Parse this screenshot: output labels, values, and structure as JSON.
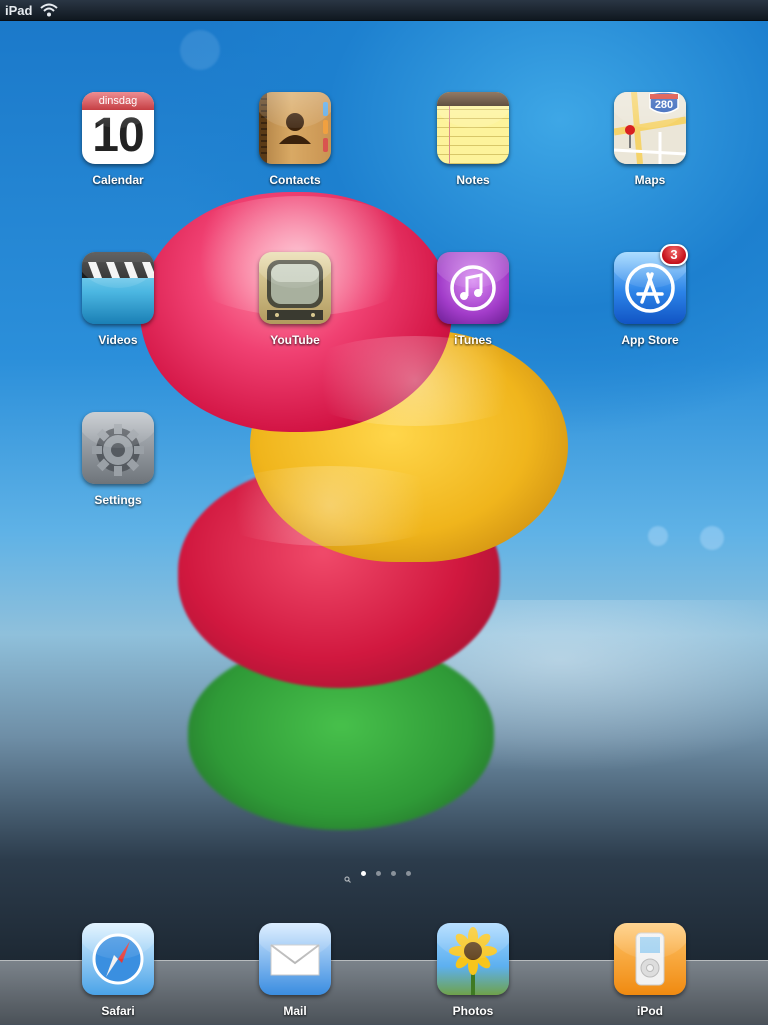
{
  "statusbar": {
    "device_name": "iPad"
  },
  "calendar_icon": {
    "weekday": "dinsdag",
    "day": "10"
  },
  "maps_icon": {
    "shield_number": "280"
  },
  "apps": [
    {
      "label": "Calendar"
    },
    {
      "label": "Contacts"
    },
    {
      "label": "Notes"
    },
    {
      "label": "Maps"
    },
    {
      "label": "Videos"
    },
    {
      "label": "YouTube"
    },
    {
      "label": "iTunes"
    },
    {
      "label": "App Store",
      "badge": "3"
    },
    {
      "label": "Settings"
    }
  ],
  "page_indicator": {
    "pages": 4,
    "current_page": 1,
    "has_spotlight": true
  },
  "dock": [
    {
      "label": "Safari"
    },
    {
      "label": "Mail"
    },
    {
      "label": "Photos"
    },
    {
      "label": "iPod"
    }
  ]
}
